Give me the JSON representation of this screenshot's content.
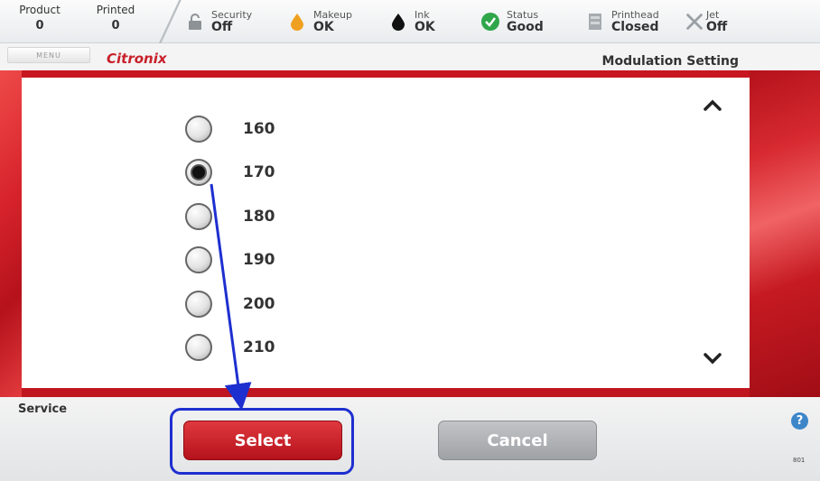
{
  "statusbar": {
    "product": {
      "label": "Product",
      "value": "0"
    },
    "printed": {
      "label": "Printed",
      "value": "0"
    },
    "security": {
      "label": "Security",
      "value": "Off",
      "icon": "lock-icon"
    },
    "makeup": {
      "label": "Makeup",
      "value": "OK",
      "icon": "makeup-drop-icon",
      "color": "#f0a020"
    },
    "ink": {
      "label": "Ink",
      "value": "OK",
      "icon": "ink-drop-icon",
      "color": "#111111"
    },
    "status": {
      "label": "Status",
      "value": "Good",
      "icon": "check-circle-icon",
      "color": "#2fa64a"
    },
    "printhead": {
      "label": "Printhead",
      "value": "Closed",
      "icon": "printhead-icon"
    },
    "jet": {
      "label": "Jet",
      "value": "Off",
      "icon": "x-icon"
    }
  },
  "header": {
    "menu_label": "MENU",
    "logo": "Citronix",
    "title": "Modulation Setting"
  },
  "options": [
    {
      "label": "160",
      "selected": false
    },
    {
      "label": "170",
      "selected": true
    },
    {
      "label": "180",
      "selected": false
    },
    {
      "label": "190",
      "selected": false
    },
    {
      "label": "200",
      "selected": false
    },
    {
      "label": "210",
      "selected": false
    }
  ],
  "footer": {
    "service_label": "Service",
    "select_label": "Select",
    "cancel_label": "Cancel",
    "help_icon": "?",
    "code": "801"
  },
  "colors": {
    "brand_red": "#c8202a",
    "annotation_blue": "#1e2fd0"
  }
}
